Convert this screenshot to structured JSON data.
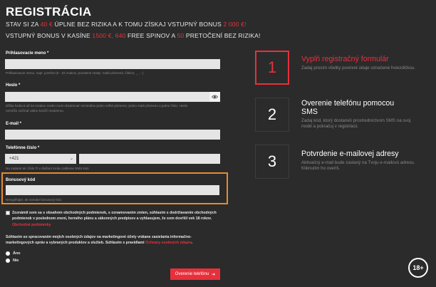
{
  "header": {
    "title": "REGISTRÁCIA",
    "promo1_pre": "STAV SI ZA ",
    "promo1_amount": "40 €",
    "promo1_mid": " ÚPLNE BEZ RIZIKA A K TOMU ZÍSKAJ VSTUPNÝ BONUS ",
    "promo1_bonus": "2 000 €!",
    "promo2_pre": "VSTUPNÝ BONUS V KASÍNE ",
    "promo2_amount": "1500 €, 640",
    "promo2_mid": " FREE SPINOV A ",
    "promo2_count": "50",
    "promo2_post": " PRETOČENÍ BEZ RIZIKA!"
  },
  "form": {
    "username_label": "Prihlasovacie meno *",
    "username_hint": "Prihlasovacie meno, napr. jozef24 (6 - 32 znakov, povolené znaky: malé písmená, číslice, _ , - )",
    "password_label": "Heslo *",
    "password_hint_1": "Dĺžka hesla 6 až 64 znakov. Heslo musí obsahovať minimálne jedno veľké písmeno, jedno malé písmeno a jedno číslo. Heslo",
    "password_hint_2": "nemôže začínať alebo končiť medzerou.",
    "email_label": "E-mail *",
    "phone_label": "Telefónne číslo *",
    "phone_prefix": "+421",
    "phone_hint": "Na zadané tel. číslo Ti v ďalšom kroku zašleme SMS kód.",
    "bonus_label": "Bonusový kód",
    "bonus_hint": "Nevypĺňajte, ak nemáte bonusový kód.",
    "terms_text": "Zoznámil som sa s obsahom obchodných podmienok, s oznamovaním zmien, súhlasím s dodržiavaním obchodných podmienok v poslednom znení, herného plánu a zákonných predpisov a vyhlasujem, že som dovŕšil vek 18 rokov. ",
    "terms_link": "Obchodné podmienky",
    "consent_text": "Súhlasím so spracovaním mojich osobných údajov na marketingové účely vrátane zasielania informačno-marketingových správ a vybraných produktov a služieb. Súhlasím s pravidlami ",
    "consent_link": "Ochrany osobných údajov",
    "consent_end": ".",
    "yes_label": "Áno",
    "no_label": "Nie",
    "submit_label": "Overenie telefónu"
  },
  "steps": [
    {
      "number": "1",
      "title": "Vyplň registračný formulár",
      "desc": "Zadaj prosím všetky povinné údaje označené hviezdičkou."
    },
    {
      "number": "2",
      "title_1": "Overenie telefónu pomocou",
      "title_2": "SMS",
      "desc": "Zadaj kód, ktorý dostaneš prostredníctvom SMS na svoj mobil a pokračuj v registrácii."
    },
    {
      "number": "3",
      "title": "Potvrdenie e-mailovej adresy",
      "desc": "Aktivačný e-mail bude zaslaný na Tvoju e-mailovú adresu. Kliknutím ho overíš."
    }
  ],
  "age_badge": "18+",
  "colors": {
    "accent": "#e8303d",
    "highlight": "#e88a2e",
    "background": "#2b2b2b"
  }
}
